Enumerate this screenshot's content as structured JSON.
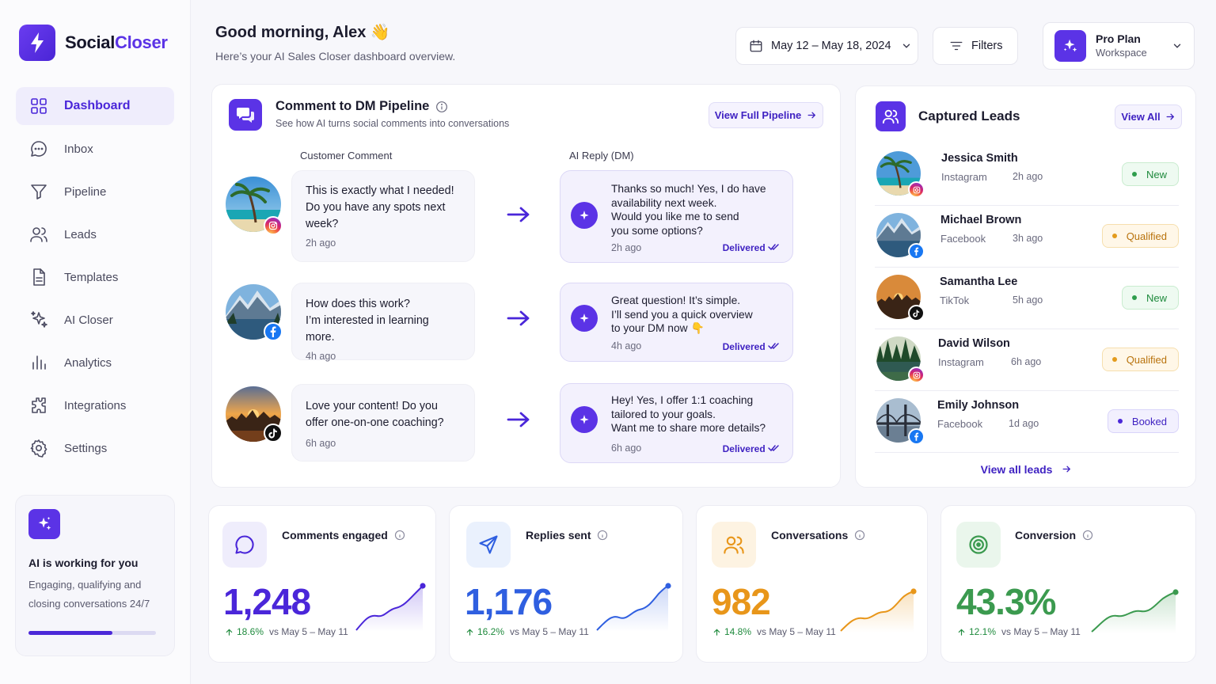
{
  "brand": {
    "name_part1": "Social",
    "name_part2": "Closer"
  },
  "nav": [
    {
      "label": "Dashboard",
      "icon": "grid-icon",
      "active": true
    },
    {
      "label": "Inbox",
      "icon": "chat-icon"
    },
    {
      "label": "Pipeline",
      "icon": "filter-funnel-icon"
    },
    {
      "label": "Leads",
      "icon": "users-icon"
    },
    {
      "label": "Templates",
      "icon": "document-icon"
    },
    {
      "label": "AI Closer",
      "icon": "sparkles-icon"
    },
    {
      "label": "Analytics",
      "icon": "bar-chart-icon"
    },
    {
      "label": "Integrations",
      "icon": "puzzle-icon"
    },
    {
      "label": "Settings",
      "icon": "gear-icon"
    }
  ],
  "ai_card": {
    "title": "AI is working for you",
    "description": "Engaging, qualifying and closing conversations 24/7",
    "progress": 0.66
  },
  "header": {
    "greeting": "Good morning, Alex 👋",
    "subtitle": "Here’s your AI Sales Closer dashboard overview.",
    "date_range": "May 12 – May 18, 2024",
    "filters_label": "Filters",
    "plan_title": "Pro Plan",
    "plan_subtitle": "Workspace"
  },
  "pipeline": {
    "title": "Comment to DM Pipeline",
    "subtitle": "See how AI turns social comments into conversations",
    "view_label": "View Full Pipeline",
    "col_comment": "Customer Comment",
    "col_reply": "AI Reply (DM)",
    "rows": [
      {
        "platform": "instagram",
        "comment_lines": [
          "This is exactly what I needed!",
          "Do you have any spots next",
          "week?"
        ],
        "comment_time": "2h ago",
        "reply_lines": [
          "Thanks so much! Yes, I do have",
          "availability next week.",
          "Would you like me to send",
          "you some options?"
        ],
        "reply_time": "2h ago",
        "status": "Delivered"
      },
      {
        "platform": "facebook",
        "comment_lines": [
          "How does this work?",
          "I’m interested in learning more."
        ],
        "comment_time": "4h ago",
        "reply_lines": [
          "Great question! It’s simple.",
          "I’ll send you a quick overview",
          "to your DM now 👇"
        ],
        "reply_time": "4h ago",
        "status": "Delivered"
      },
      {
        "platform": "tiktok",
        "comment_lines": [
          "Love your content! Do you",
          "offer one-on-one coaching?"
        ],
        "comment_time": "6h ago",
        "reply_lines": [
          "Hey! Yes, I offer 1:1 coaching",
          "tailored to your goals.",
          "Want me to share more details?"
        ],
        "reply_time": "6h ago",
        "status": "Delivered"
      }
    ]
  },
  "leads": {
    "title": "Captured Leads",
    "view_label": "View All",
    "view_all_label": "View all leads",
    "items": [
      {
        "name": "Jessica Smith",
        "platform": "Instagram",
        "time": "2h ago",
        "status": "New"
      },
      {
        "name": "Michael Brown",
        "platform": "Facebook",
        "time": "3h ago",
        "status": "Qualified"
      },
      {
        "name": "Samantha Lee",
        "platform": "TikTok",
        "time": "5h ago",
        "status": "New"
      },
      {
        "name": "David Wilson",
        "platform": "Instagram",
        "time": "6h ago",
        "status": "Qualified"
      },
      {
        "name": "Emily Johnson",
        "platform": "Facebook",
        "time": "1d ago",
        "status": "Booked"
      }
    ]
  },
  "stats": [
    {
      "label": "Comments engaged",
      "value": "1,248",
      "change": "18.6%",
      "compare": "vs May 5 – May 11",
      "color": "#4a26d9",
      "icon": "chat-bubble-icon"
    },
    {
      "label": "Replies sent",
      "value": "1,176",
      "change": "16.2%",
      "compare": "vs May 5 – May 11",
      "color": "#2f5fe0",
      "icon": "send-icon"
    },
    {
      "label": "Conversations",
      "value": "982",
      "change": "14.8%",
      "compare": "vs May 5 – May 11",
      "color": "#e8961a",
      "icon": "users-icon"
    },
    {
      "label": "Conversion",
      "value": "43.3%",
      "change": "12.1%",
      "compare": "vs May 5 – May 11",
      "color": "#3b9a4f",
      "icon": "target-icon"
    }
  ]
}
